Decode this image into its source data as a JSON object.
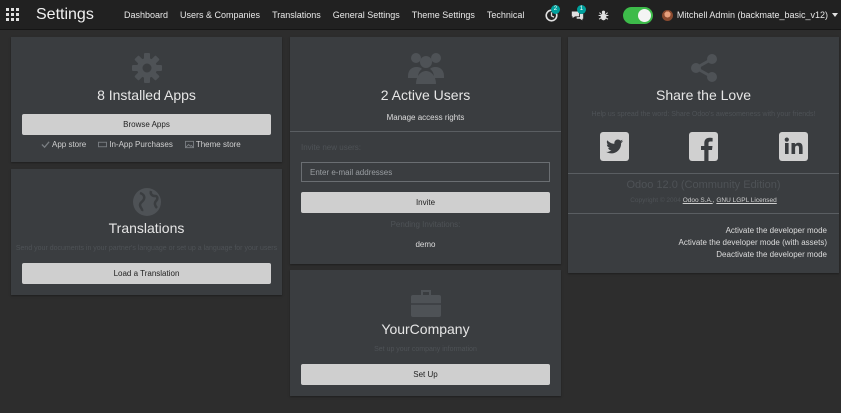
{
  "navbar": {
    "brand": "Settings",
    "menu": [
      {
        "label": "Dashboard"
      },
      {
        "label": "Users & Companies"
      },
      {
        "label": "Translations"
      },
      {
        "label": "General Settings"
      },
      {
        "label": "Theme Settings"
      },
      {
        "label": "Technical"
      }
    ],
    "activity_count": "2",
    "message_count": "1",
    "user_name": "Mitchell Admin (backmate_basic_v12)",
    "toggle_on": true,
    "toggle_color": "#3dbb4a"
  },
  "apps_card": {
    "title": "8 Installed Apps",
    "button": "Browse Apps",
    "links": [
      "App store",
      "In-App Purchases",
      "Theme store"
    ]
  },
  "translations_card": {
    "title": "Translations",
    "subtitle": "Send your documents in your partner's language or set up a language for your users",
    "button": "Load a Translation"
  },
  "users_card": {
    "title": "2 Active Users",
    "manage_link": "Manage access rights",
    "invite_label": "Invite new users:",
    "email_placeholder": "Enter e-mail addresses",
    "invite_button": "Invite",
    "pending_label": "Pending Invitations:",
    "pending_users": [
      "demo"
    ]
  },
  "company_card": {
    "title": "YourCompany",
    "subtitle": "Set up your company information",
    "button": "Set Up"
  },
  "share_card": {
    "title": "Share the Love",
    "subtitle": "Help us spread the word: Share Odoo's awesomeness with your friends!",
    "edition": "Odoo 12.0 (Community Edition)",
    "copyright_prefix": "Copyright ©  2004",
    "copyright_link1": "Odoo S.A.",
    "copyright_link2": "GNU LGPL Licensed",
    "dev_links": [
      "Activate the developer mode",
      "Activate the developer mode (with assets)",
      "Deactivate the developer mode"
    ]
  },
  "colors": {
    "background": "#2d2d2d",
    "card": "#3a3d40",
    "navbar": "#212121",
    "badge": "#00a09d"
  }
}
